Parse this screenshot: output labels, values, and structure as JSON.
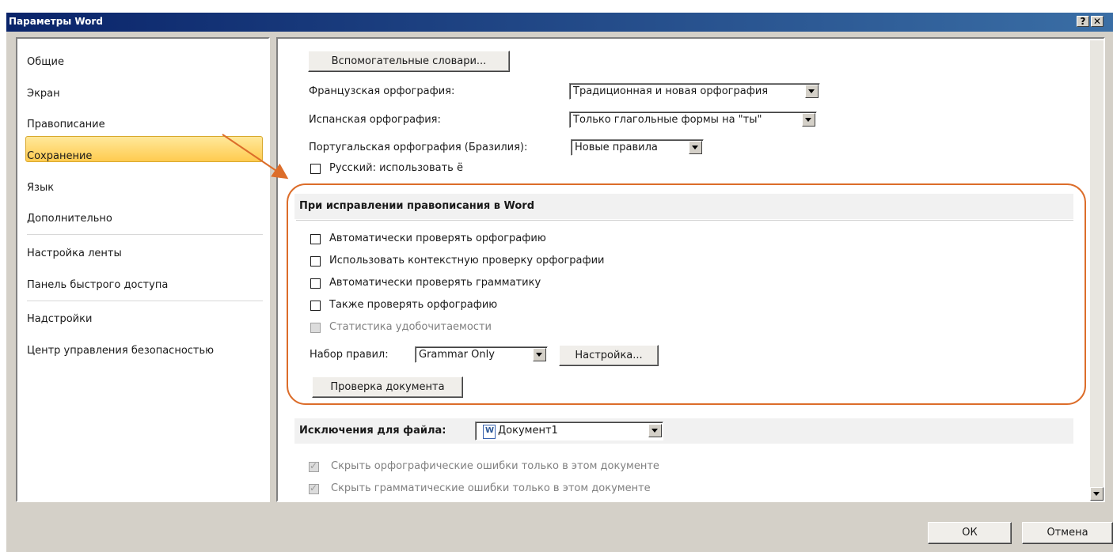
{
  "window": {
    "title": "Параметры Word",
    "help_glyph": "?",
    "close_glyph": "✕"
  },
  "nav": {
    "items": [
      "Общие",
      "Экран",
      "Правописание",
      "Сохранение",
      "Язык",
      "Дополнительно",
      "Настройка ленты",
      "Панель быстрого доступа",
      "Надстройки",
      "Центр управления безопасностью"
    ],
    "selected": "Правописание"
  },
  "content": {
    "dictionaries_button": "Вспомогательные словари...",
    "french_label": "Французская орфография:",
    "french_value": "Традиционная и новая орфография",
    "spanish_label": "Испанская орфография:",
    "spanish_value": "Только глагольные формы на \"ты\"",
    "portuguese_label": "Португальская орфография (Бразилия):",
    "portuguese_value": "Новые правила",
    "russian_yo": "Русский: использовать ё",
    "word_section": {
      "title": "При исправлении правописания в Word",
      "check_spelling": "Автоматически проверять орфографию",
      "contextual": "Использовать контекстную проверку орфографии",
      "check_grammar": "Автоматически проверять грамматику",
      "also_spelling": "Также проверять орфографию",
      "readability": "Статистика удобочитаемости",
      "ruleset_label": "Набор правил:",
      "ruleset_value": "Grammar Only",
      "settings_button": "Настройка...",
      "check_document_button": "Проверка документа"
    },
    "exceptions": {
      "label": "Исключения для файла:",
      "document": "Документ1",
      "hide_spelling": "Скрыть орфографические ошибки только в этом документе",
      "hide_grammar": "Скрыть грамматические ошибки только в этом документе"
    }
  },
  "footer": {
    "ok": "ОК",
    "cancel": "Отмена"
  },
  "colors": {
    "accent": "#dc6d2a",
    "selection": "#ffcb4f",
    "titlebar": "#0a246a"
  }
}
